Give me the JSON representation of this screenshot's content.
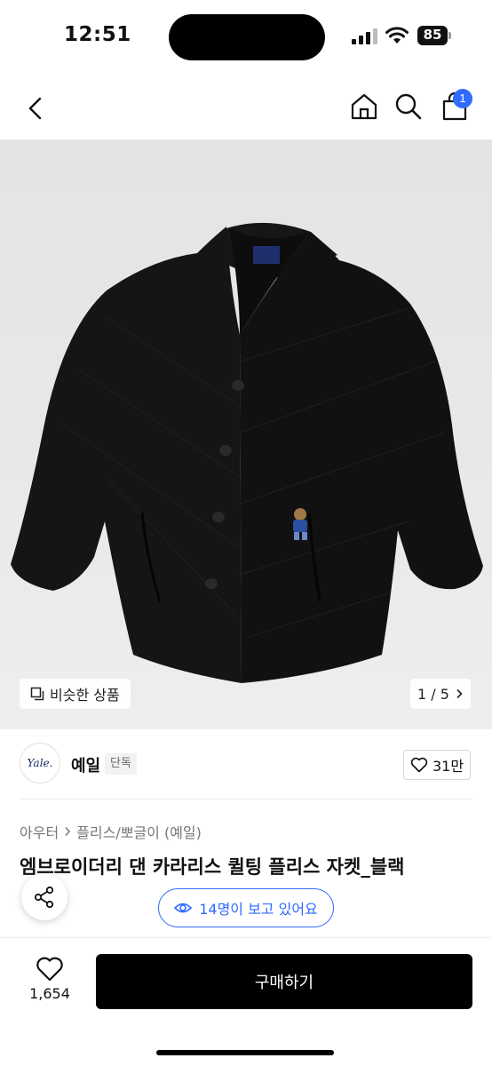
{
  "status_bar": {
    "time": "12:51",
    "battery": "85"
  },
  "nav": {
    "cart_badge": "1"
  },
  "gallery": {
    "similar_label": "비슷한 상품",
    "pager": "1 / 5"
  },
  "brand": {
    "logo_text": "Yale.",
    "name": "예일",
    "tag": "단독",
    "likes": "31만"
  },
  "breadcrumb": {
    "items": [
      "아우터",
      "플리스/뽀글이 (예일)"
    ]
  },
  "product": {
    "title": "엠브로이더리 댄 카라리스 퀼팅 플리스 자켓_블랙"
  },
  "viewers": {
    "label": "14명이 보고 있어요"
  },
  "bottom_bar": {
    "wish_count": "1,654",
    "buy_label": "구매하기"
  },
  "colors": {
    "accent": "#2f6bff",
    "buy_button": "#000000"
  }
}
